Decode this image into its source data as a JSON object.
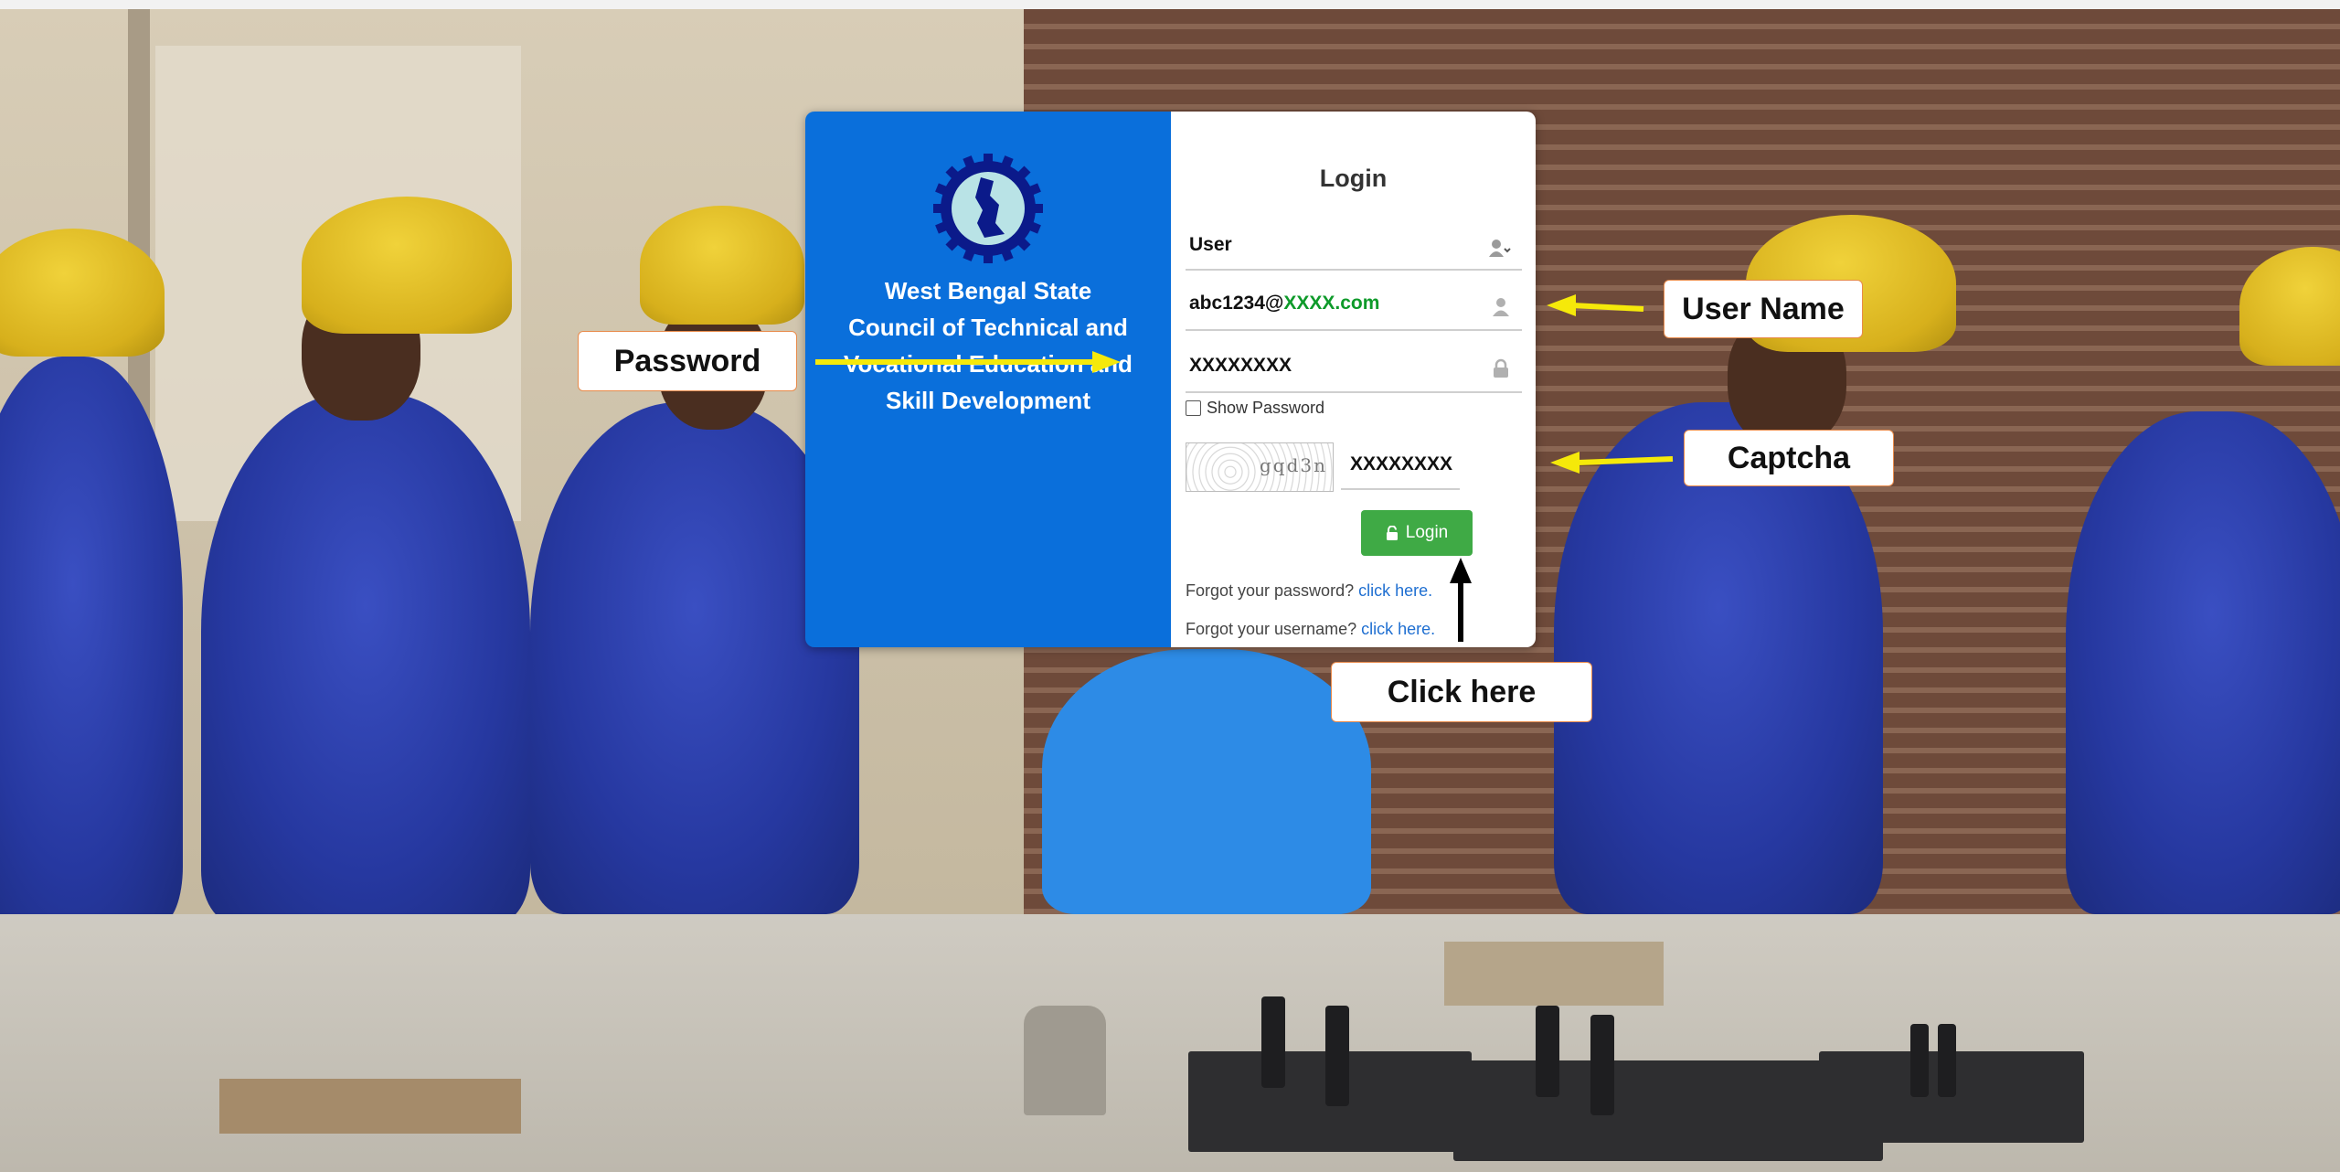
{
  "login": {
    "title": "Login",
    "role_value": "User",
    "username_prefix": "abc1234@",
    "username_domain": "XXXX.com",
    "password_value": "XXXXXXXX",
    "show_password_label": "Show Password",
    "captcha_image_text": "gqd3n",
    "captcha_value": "XXXXXXXX",
    "login_button": "Login",
    "forgot_password_text": "Forgot your password?",
    "forgot_username_text": "Forgot your username?",
    "click_here_link": "click here."
  },
  "organization": {
    "name": "West Bengal State Council of Technical and Vocational Education and Skill Development"
  },
  "annotations": {
    "password": "Password",
    "username": "User Name",
    "captcha": "Captcha",
    "click_here": "Click here"
  },
  "colors": {
    "panel_blue": "#0a6fdb",
    "login_green": "#3faa45",
    "link_blue": "#1f6fd1",
    "domain_green": "#0e9a2a",
    "arrow_yellow": "#f5e90a",
    "arrow_black": "#000000"
  },
  "icons": {
    "role": "user-dropdown-icon",
    "username": "user-icon",
    "password": "lock-icon",
    "login": "unlock-icon"
  }
}
